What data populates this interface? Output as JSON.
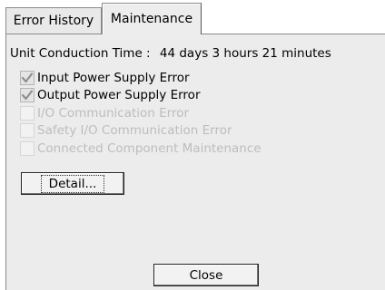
{
  "tabs": [
    {
      "label": "Error History",
      "active": false
    },
    {
      "label": "Maintenance",
      "active": true
    }
  ],
  "maintenance": {
    "conduction_label": "Unit Conduction Time :",
    "conduction_value": "44 days 3 hours 21 minutes",
    "items": [
      {
        "label": "Input Power Supply Error",
        "checked": true,
        "enabled": true
      },
      {
        "label": "Output Power Supply Error",
        "checked": true,
        "enabled": true
      },
      {
        "label": "I/O Communication Error",
        "checked": false,
        "enabled": false
      },
      {
        "label": "Safety I/O Communication Error",
        "checked": false,
        "enabled": false
      },
      {
        "label": "Connected Component Maintenance",
        "checked": false,
        "enabled": false
      }
    ],
    "detail_label": "Detail...",
    "close_label": "Close"
  },
  "colors": {
    "panel_bg": "#ececec",
    "check_mark": "#8f8f8f",
    "disabled_text": "#bdbdbd"
  },
  "icons": {
    "checkbox_checked": "checkmark-icon"
  }
}
